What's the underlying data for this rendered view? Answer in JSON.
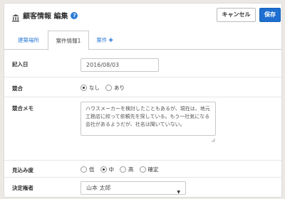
{
  "header": {
    "title": "顧客情報 編集",
    "help_symbol": "?",
    "cancel_label": "キャンセル",
    "save_label": "保存"
  },
  "tabs": [
    {
      "label": "建築場所",
      "active": false
    },
    {
      "label": "案件情報1",
      "active": true
    },
    {
      "label": "案件",
      "active": false,
      "add_symbol": "✚"
    }
  ],
  "form": {
    "entry_date": {
      "label": "記入日",
      "value": "2016/08/03"
    },
    "competition": {
      "label": "競合",
      "options": [
        {
          "label": "なし",
          "checked": true
        },
        {
          "label": "あり",
          "checked": false
        }
      ]
    },
    "competition_memo": {
      "label": "競合メモ",
      "value": "ハウスメーカーを検討したこともあるが、現在は、地元工務店に絞って依頼先を探している。もう一社気になる会社があるようだが、社名は聞いていない。"
    },
    "prospect": {
      "label": "見込み度",
      "options": [
        {
          "label": "低",
          "checked": false
        },
        {
          "label": "中",
          "checked": true
        },
        {
          "label": "高",
          "checked": false
        },
        {
          "label": "確定",
          "checked": false
        }
      ]
    },
    "decision_maker": {
      "label": "決定権者",
      "value": "山本 太郎"
    }
  },
  "colors": {
    "accent": "#2c7bd6",
    "save_button": "#1e6fd0",
    "background": "#ece8e4"
  }
}
